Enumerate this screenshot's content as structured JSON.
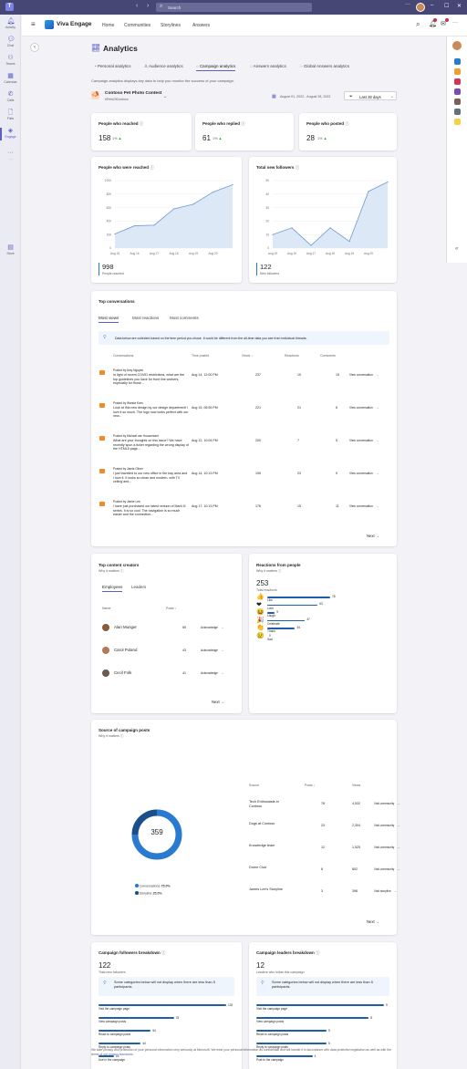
{
  "search": {
    "placeholder": "Search"
  },
  "app": {
    "name": "Viva Engage",
    "nav": [
      "Home",
      "Communities",
      "Storylines",
      "Answers"
    ]
  },
  "rail": [
    {
      "label": "Activity",
      "icon": "bell-icon"
    },
    {
      "label": "Chat",
      "icon": "chat-icon"
    },
    {
      "label": "Teams",
      "icon": "teams-icon"
    },
    {
      "label": "Calendar",
      "icon": "calendar-icon"
    },
    {
      "label": "Calls",
      "icon": "phone-icon"
    },
    {
      "label": "Files",
      "icon": "file-icon"
    },
    {
      "label": "Engage",
      "icon": "engage-icon"
    },
    {
      "label": "...",
      "icon": "more-icon"
    },
    {
      "label": "Store",
      "icon": "store-icon"
    }
  ],
  "page": {
    "title": "Analytics",
    "tabs": [
      "Personal analytics",
      "Audience analytics",
      "Campaign analytics",
      "Answers analytics",
      "Global Answers analytics"
    ],
    "description": "Campaign analytics displays key data to help you monitor the success of your campaign.",
    "campaign_name": "Contoso Pet Photo Contest",
    "campaign_tag": "#PetsOfContoso",
    "date_range": "August 01, 2022 - August 28, 2022",
    "period": "Last 28 days"
  },
  "stats": [
    {
      "title": "People who reached",
      "value": "158",
      "delta": "1%"
    },
    {
      "title": "People who replied",
      "value": "61",
      "delta": "1%"
    },
    {
      "title": "People who posted",
      "value": "28",
      "delta": "1%"
    }
  ],
  "reached_chart": {
    "title": "People who were reached",
    "total": "998",
    "total_label": "People reached",
    "color": "#6c9bd2"
  },
  "followers_chart": {
    "title": "Total new followers",
    "total": "122",
    "total_label": "New followers",
    "color": "#6c9bd2"
  },
  "chart_data": [
    {
      "type": "area",
      "title": "People who were reached",
      "x": [
        "Aug 15",
        "Aug 16",
        "Aug 17",
        "Aug 18",
        "Aug 19",
        "Aug 20",
        "Aug 21"
      ],
      "x_ticks": [
        "Aug 15",
        "Aug 16",
        "Aug 17",
        "Aug 18",
        "Aug 19",
        "Aug 20"
      ],
      "y_ticks": [
        "0",
        "200",
        "400",
        "600",
        "800",
        "1000"
      ],
      "values": [
        210,
        330,
        340,
        580,
        650,
        830,
        940
      ],
      "ylim": [
        0,
        1000
      ],
      "grid": true
    },
    {
      "type": "area",
      "title": "Total new followers",
      "x": [
        "Aug 15",
        "Aug 16",
        "Aug 17",
        "Aug 18",
        "Aug 19",
        "Aug 20",
        "Aug 21"
      ],
      "x_ticks": [
        "Aug 15",
        "Aug 16",
        "Aug 17",
        "Aug 18",
        "Aug 19",
        "Aug 20"
      ],
      "y_ticks": [
        "0",
        "10",
        "20",
        "30",
        "40",
        "50"
      ],
      "values": [
        10,
        15,
        2,
        15,
        5,
        42,
        49
      ],
      "ylim": [
        0,
        50
      ],
      "grid": true
    },
    {
      "type": "bar",
      "title": "Reactions from people",
      "total": "253",
      "categories": [
        "Like",
        "Love",
        "Laugh",
        "Celebrate",
        "Thank",
        "Sad"
      ],
      "values": [
        78,
        63,
        9,
        47,
        34,
        0
      ]
    },
    {
      "type": "pie",
      "title": "Source of campaign posts",
      "total": "359",
      "categories": [
        "Conversations",
        "Storyline"
      ],
      "values": [
        75.0,
        25.0
      ]
    },
    {
      "type": "bar",
      "title": "Campaign followers breakdown",
      "total": "122",
      "categories": [
        "Visit the campaign page",
        "View campaign posts",
        "React to campaign posts",
        "Reply to campaign posts",
        "Use in the campaign"
      ],
      "values": [
        132,
        78,
        54,
        44,
        16
      ]
    },
    {
      "type": "bar",
      "title": "Campaign leaders breakdown",
      "total": "12",
      "categories": [
        "Visit the campaign page",
        "View campaign posts",
        "React to campaign posts",
        "Reply to campaign posts",
        "Post to the campaign"
      ],
      "values": [
        9,
        8,
        5,
        5,
        4
      ]
    }
  ],
  "top_conversations": {
    "title": "Top conversations",
    "tabs": [
      "Most views",
      "Most reactions",
      "Most comments"
    ],
    "info": "Data below are collected based on the time period you chose. It could be different from the all-time data you see from individual threads.",
    "headers": [
      "Conversations",
      "Time posted",
      "Views",
      "Reactions",
      "Comments"
    ],
    "rows": [
      {
        "by": "Posted by Amy Nguyen",
        "text": "In light of recent COVID restrictions, what are the top guidelines you have for front line workers, especially for those...",
        "time": "Aug 14, 12:00 PM",
        "views": "237",
        "reactions": "10",
        "comments": "15",
        "action": "View conversation"
      },
      {
        "by": "Posted by Wanda Kam",
        "text": "Look at this new design by our design department! I love it so much. The logo now looks perfect with our new...",
        "time": "Aug 15, 06:55 PM",
        "views": "221",
        "reactions": "21",
        "comments": "6",
        "action": "View conversation"
      },
      {
        "by": "Posted by Michael van Houwenlanf",
        "text": "What are your thoughts on this issue? We have recently spun a ticket regarding the wrong display of the HTML5 page...",
        "time": "Aug 12, 10:04 PM",
        "views": "200",
        "reactions": "7",
        "comments": "5",
        "action": "View conversation"
      },
      {
        "by": "Posted by Jamie Oliver",
        "text": "I just travelled to our new office in the bay area and I love it. It looks so clean and modern, with TV ceiling and...",
        "time": "Aug 14, 10:13 PM",
        "views": "190",
        "reactions": "23",
        "comments": "9",
        "action": "View conversation"
      },
      {
        "by": "Posted by Jamie Lee",
        "text": "I have just purchased our latest version of Mark III series. It is so cool. The navigation is so much easier and the connection...",
        "time": "Aug 17, 10:13 PM",
        "views": "176",
        "reactions": "15",
        "comments": "11",
        "action": "View conversation"
      }
    ],
    "next": "Next"
  },
  "creators": {
    "title": "Top content creators",
    "why": "Why it matters",
    "tabs": [
      "Employees",
      "Leaders"
    ],
    "headers": [
      "Name",
      "Posts"
    ],
    "rows": [
      {
        "name": "Alan Munger",
        "posts": "55",
        "action": "Acknowledge"
      },
      {
        "name": "Carol Poland",
        "posts": "43",
        "action": "Acknowledge"
      },
      {
        "name": "Cecil Folk",
        "posts": "41",
        "action": "Acknowledge"
      }
    ],
    "next": "Next"
  },
  "reactions": {
    "title": "Reactions from people",
    "why": "Why it matters",
    "total": "253",
    "total_label": "Total reactions",
    "items": [
      {
        "label": "Like",
        "value": "78",
        "emoji": "👍",
        "ratio": 0.5
      },
      {
        "label": "Love",
        "value": "63",
        "emoji": "❤",
        "ratio": 0.4
      },
      {
        "label": "Laugh",
        "value": "9",
        "emoji": "😆",
        "ratio": 0.06
      },
      {
        "label": "Celebrate",
        "value": "47",
        "emoji": "🎉",
        "ratio": 0.3
      },
      {
        "label": "Thank",
        "value": "34",
        "emoji": "👏",
        "ratio": 0.22
      },
      {
        "label": "Sad",
        "value": "0",
        "emoji": "😢",
        "ratio": 0
      }
    ]
  },
  "sources": {
    "title": "Source of campaign posts",
    "why": "Why it matters",
    "total": "359",
    "legend": [
      {
        "label": "Conversations",
        "value": "75.0%",
        "color": "#2a7ad1"
      },
      {
        "label": "Storyline",
        "value": "25.0%",
        "color": "#1b4f8c"
      }
    ],
    "headers": [
      "Source",
      "Posts",
      "Views"
    ],
    "rows": [
      {
        "source": "Tech Enthusiasts in Contoso",
        "posts": "78",
        "views": "4,532",
        "action": "Visit community"
      },
      {
        "source": "Dogs at Contoso",
        "posts": "23",
        "views": "2,304",
        "action": "Visit community"
      },
      {
        "source": "Knowledge team",
        "posts": "12",
        "views": "1,525",
        "action": "Visit community"
      },
      {
        "source": "Drone Club",
        "posts": "8",
        "views": "802",
        "action": "Visit community"
      },
      {
        "source": "James Lee's Storyline",
        "posts": "3",
        "views": "398",
        "action": "Visit storyline"
      }
    ],
    "next": "Next"
  },
  "followers_breakdown": {
    "title": "Campaign followers breakdown",
    "total": "122",
    "total_label": "Total new followers",
    "info": "Some categories below will not display when there are less than 5 participants.",
    "items": [
      {
        "label": "Visit the campaign page",
        "value": "132",
        "ratio": 1.0
      },
      {
        "label": "View campaign posts",
        "value": "78",
        "ratio": 0.59
      },
      {
        "label": "React to campaign posts",
        "value": "54",
        "ratio": 0.41
      },
      {
        "label": "Reply to campaign posts",
        "value": "44",
        "ratio": 0.33
      },
      {
        "label": "Use in the campaign",
        "value": "16",
        "ratio": 0.12
      }
    ]
  },
  "leaders_breakdown": {
    "title": "Campaign leaders breakdown",
    "total": "12",
    "total_label": "Leaders who follow this campaign",
    "info": "Some categories below will not display when there are less than 5 participants.",
    "items": [
      {
        "label": "Visit the campaign page",
        "value": "9",
        "ratio": 1.0
      },
      {
        "label": "View campaign posts",
        "value": "8",
        "ratio": 0.88
      },
      {
        "label": "React to campaign posts",
        "value": "5",
        "ratio": 0.55
      },
      {
        "label": "Reply to campaign posts",
        "value": "5",
        "ratio": 0.55
      },
      {
        "label": "Post to the campaign",
        "value": "4",
        "ratio": 0.44
      }
    ]
  },
  "footer": {
    "text": "We take privacy and protection of your personal information very seriously at Microsoft. We treat your personal information as confidential and will handle it in accordance with data protection legislation as well as with the terms of our",
    "link": "privacy standards."
  }
}
